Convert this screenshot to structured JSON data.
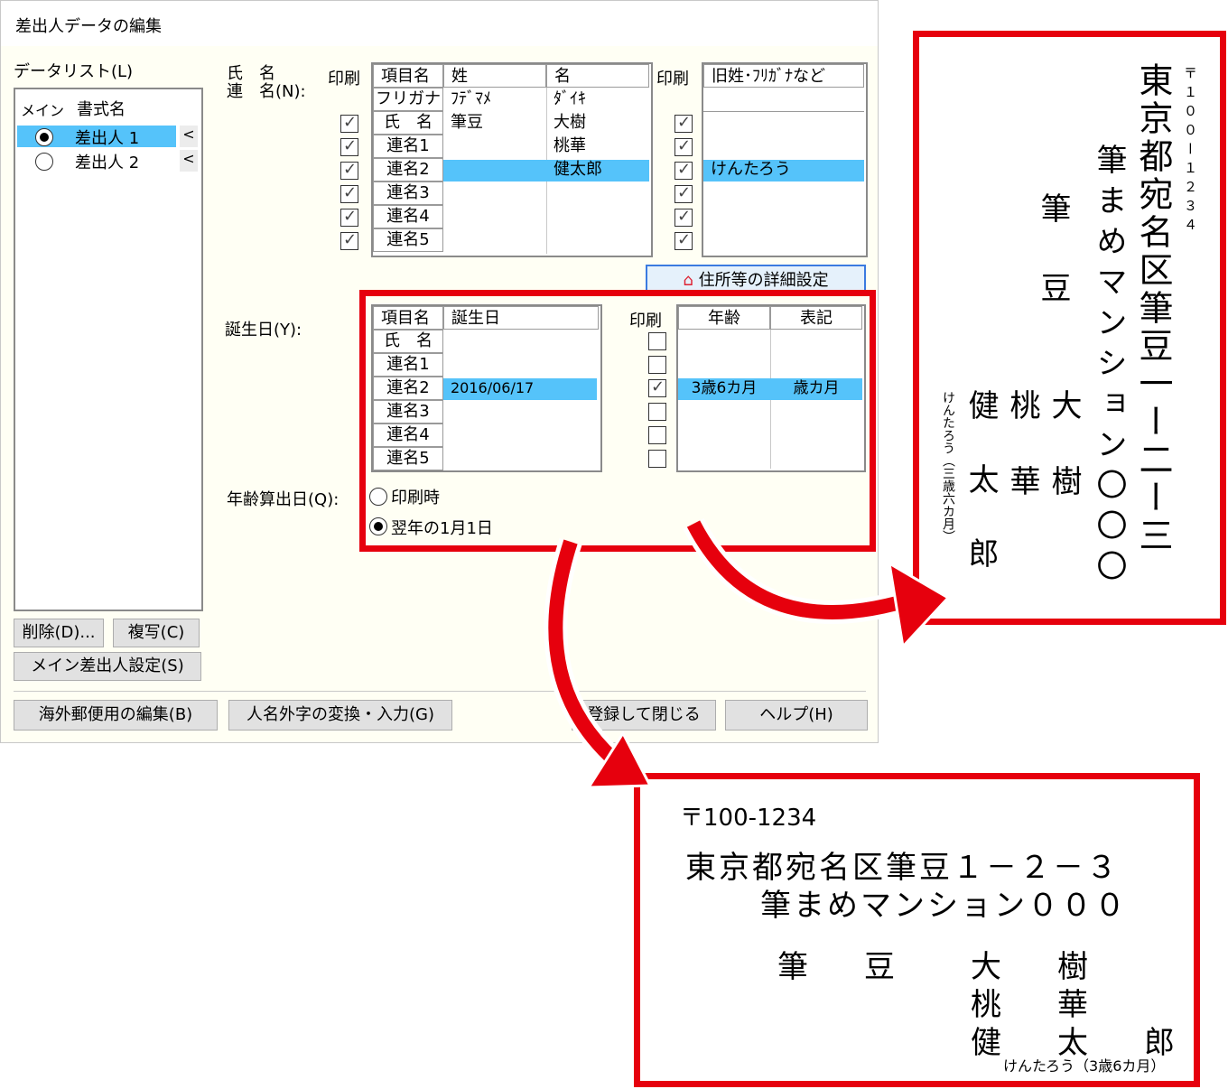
{
  "dialog": {
    "title": "差出人データの編集",
    "data_list_label": "データリスト(L)",
    "list_headers": [
      "メイン",
      "書式名"
    ],
    "list_items": [
      {
        "name": "差出人 1",
        "main": true,
        "arrow": "<"
      },
      {
        "name": "差出人 2",
        "main": false,
        "arrow": "<"
      }
    ],
    "buttons": {
      "delete": "削除(D)...",
      "copy": "複写(C)",
      "main_sender": "メイン差出人設定(S)",
      "overseas": "海外郵便用の編集(B)",
      "gaiji": "人名外字の変換・入力(G)",
      "register_close": "登録して閉じる",
      "help": "ヘルプ(H)",
      "address_detail": "住所等の詳細設定"
    },
    "names_section": {
      "label_1": "氏　名",
      "label_2": "連　名(N):",
      "print_label": "印刷",
      "headers": [
        "項目名",
        "姓",
        "名"
      ],
      "rows": [
        {
          "item": "フリガナ",
          "sei": "ﾌﾃﾞﾏﾒ",
          "mei": "ﾀﾞｲｷ"
        },
        {
          "item": "氏　名",
          "sei": "筆豆",
          "mei": "大樹",
          "print": true
        },
        {
          "item": "連名1",
          "sei": "",
          "mei": "桃華",
          "print": true
        },
        {
          "item": "連名2",
          "sei": "",
          "mei": "健太郎",
          "print": true,
          "selected": true
        },
        {
          "item": "連名3",
          "sei": "",
          "mei": "",
          "print": true
        },
        {
          "item": "連名4",
          "sei": "",
          "mei": "",
          "print": true
        },
        {
          "item": "連名5",
          "sei": "",
          "mei": "",
          "print": true
        }
      ],
      "print_label_2": "印刷",
      "extra_header": "旧姓･ﾌﾘｶﾞﾅなど",
      "extra_rows": [
        {
          "value": "",
          "print": true
        },
        {
          "value": "",
          "print": true
        },
        {
          "value": "けんたろう",
          "print": true,
          "selected": true
        },
        {
          "value": "",
          "print": true
        },
        {
          "value": "",
          "print": true
        },
        {
          "value": "",
          "print": true
        }
      ]
    },
    "birthday_section": {
      "label": "誕生日(Y):",
      "headers": [
        "項目名",
        "誕生日"
      ],
      "rows": [
        {
          "item": "氏　名",
          "date": "",
          "print": false,
          "age": "",
          "notation": ""
        },
        {
          "item": "連名1",
          "date": "",
          "print": false,
          "age": "",
          "notation": ""
        },
        {
          "item": "連名2",
          "date": "2016/06/17",
          "print": true,
          "age": "3歳6カ月",
          "notation": "歳カ月",
          "selected": true
        },
        {
          "item": "連名3",
          "date": "",
          "print": false,
          "age": "",
          "notation": ""
        },
        {
          "item": "連名4",
          "date": "",
          "print": false,
          "age": "",
          "notation": ""
        },
        {
          "item": "連名5",
          "date": "",
          "print": false,
          "age": "",
          "notation": ""
        }
      ],
      "print_label": "印刷",
      "age_headers": [
        "年齢",
        "表記"
      ],
      "calc_label": "年齢算出日(Q):",
      "calc_options": [
        {
          "label": "印刷時",
          "selected": false
        },
        {
          "label": "翌年の1月1日",
          "selected": true
        }
      ]
    }
  },
  "vertical_preview": {
    "postal": "〒１００ー１２３４",
    "address_1": "東京都宛名区筆豆一ー二ー三",
    "address_2": "筆まめマンション〇〇〇",
    "surname_1": "筆",
    "surname_2": "豆",
    "name_1": "大樹",
    "name_2": "桃華",
    "name_3": "健太郎",
    "note": "けんたろう（三歳六カ月）"
  },
  "horizontal_preview": {
    "postal": "〒100-1234",
    "address_1": "東京都宛名区筆豆１－２－３",
    "address_2": "筆まめマンション０００",
    "surname": "筆　豆",
    "name_1": "大　樹",
    "name_2": "桃　華",
    "name_3": "健　太　郎",
    "note": "けんたろう（3歳6カ月）"
  },
  "colors": {
    "highlight": "#55c3fa",
    "callout": "#e6000d",
    "dialog_bg": "#fffff4"
  }
}
